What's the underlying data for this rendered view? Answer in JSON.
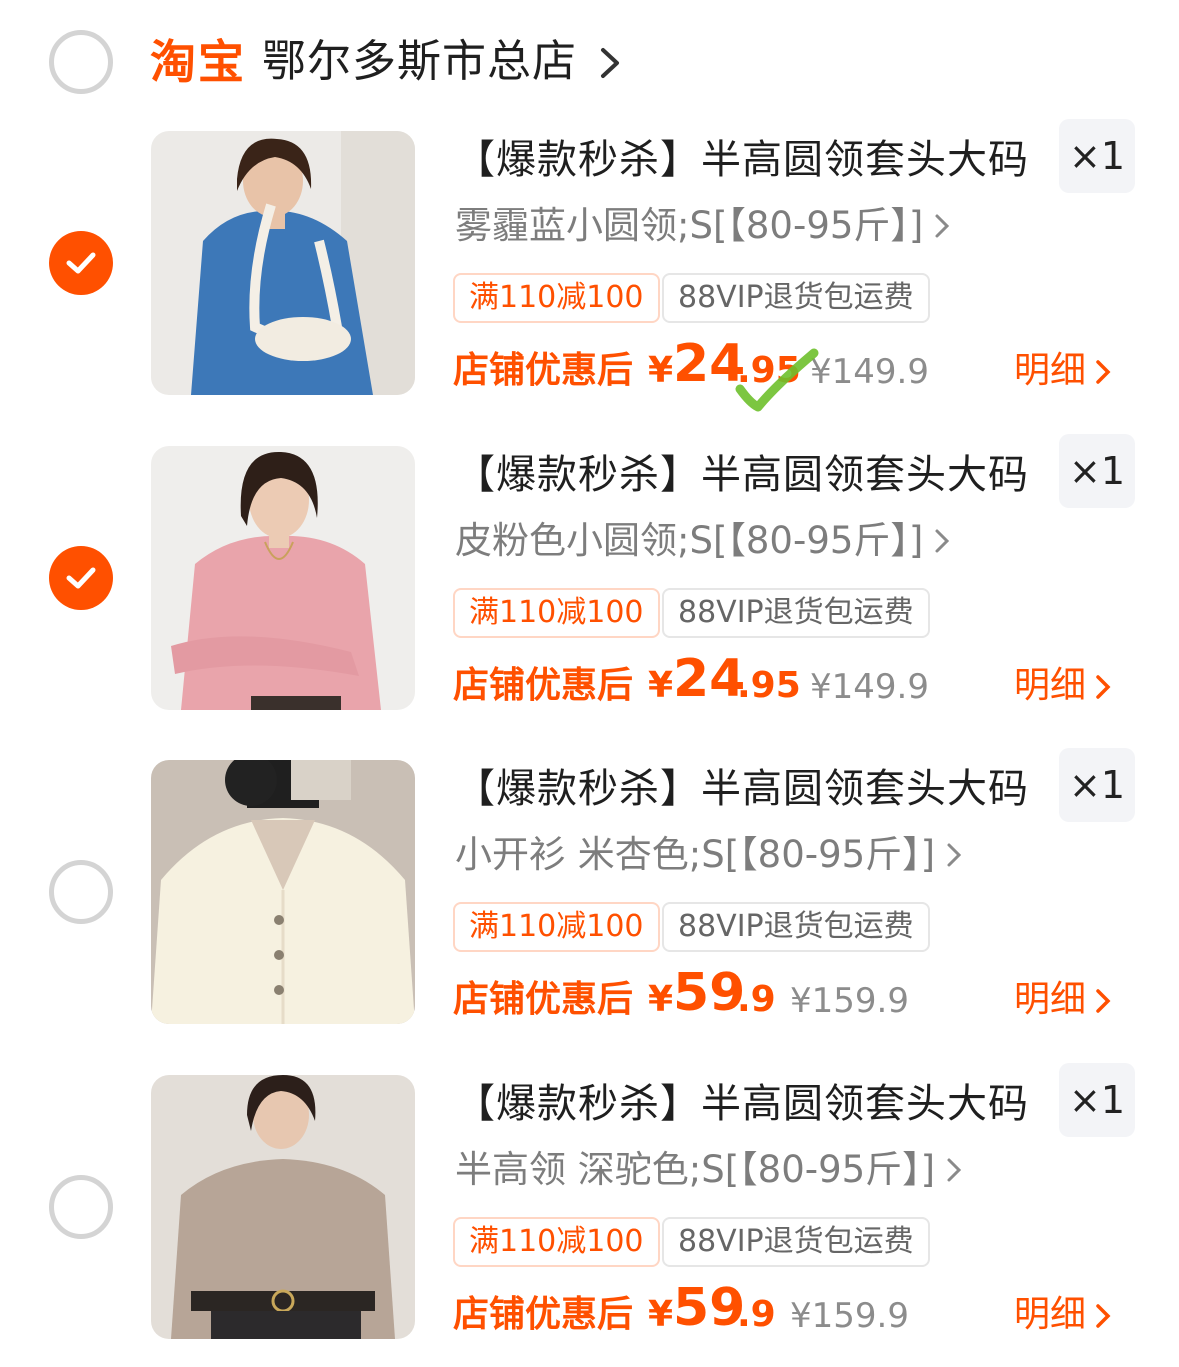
{
  "colors": {
    "accent": "#ff5000",
    "muted": "#7d7d7d",
    "qty_bg": "#f3f4f7"
  },
  "shop": {
    "brand": "淘宝",
    "name": "鄂尔多斯市总店",
    "selected": false,
    "icon": "chevron-right-icon"
  },
  "items": [
    {
      "selected": true,
      "image": "blue-sweater-photo",
      "title": "【爆款秒杀】半高圆领套头大码",
      "qty": "×1",
      "sku": "雾霾蓝小圆领;S[【80-95斤】]",
      "tag_promo": "满110减100",
      "tag_vip": "88VIP退货包运费",
      "price_label": "店铺优惠后",
      "price_currency": "¥",
      "price_int": "24",
      "price_dec": ".95",
      "orig_price": "¥149.9",
      "detail_label": "明细"
    },
    {
      "selected": true,
      "image": "pink-sweater-photo",
      "title": "【爆款秒杀】半高圆领套头大码",
      "qty": "×1",
      "sku": "皮粉色小圆领;S[【80-95斤】]",
      "tag_promo": "满110减100",
      "tag_vip": "88VIP退货包运费",
      "price_label": "店铺优惠后",
      "price_currency": "¥",
      "price_int": "24",
      "price_dec": ".95",
      "orig_price": "¥149.9",
      "detail_label": "明细"
    },
    {
      "selected": false,
      "image": "cream-cardigan-photo",
      "title": "【爆款秒杀】半高圆领套头大码",
      "qty": "×1",
      "sku": "小开衫 米杏色;S[【80-95斤】]",
      "tag_promo": "满110减100",
      "tag_vip": "88VIP退货包运费",
      "price_label": "店铺优惠后",
      "price_currency": "¥",
      "price_int": "59",
      "price_dec": ".9",
      "orig_price": "¥159.9",
      "detail_label": "明细"
    },
    {
      "selected": false,
      "image": "camel-sweater-photo",
      "title": "【爆款秒杀】半高圆领套头大码",
      "qty": "×1",
      "sku": "半高领 深驼色;S[【80-95斤】]",
      "tag_promo": "满110减100",
      "tag_vip": "88VIP退货包运费",
      "price_label": "店铺优惠后",
      "price_currency": "¥",
      "price_int": "59",
      "price_dec": ".9",
      "orig_price": "¥159.9",
      "detail_label": "明细"
    }
  ]
}
